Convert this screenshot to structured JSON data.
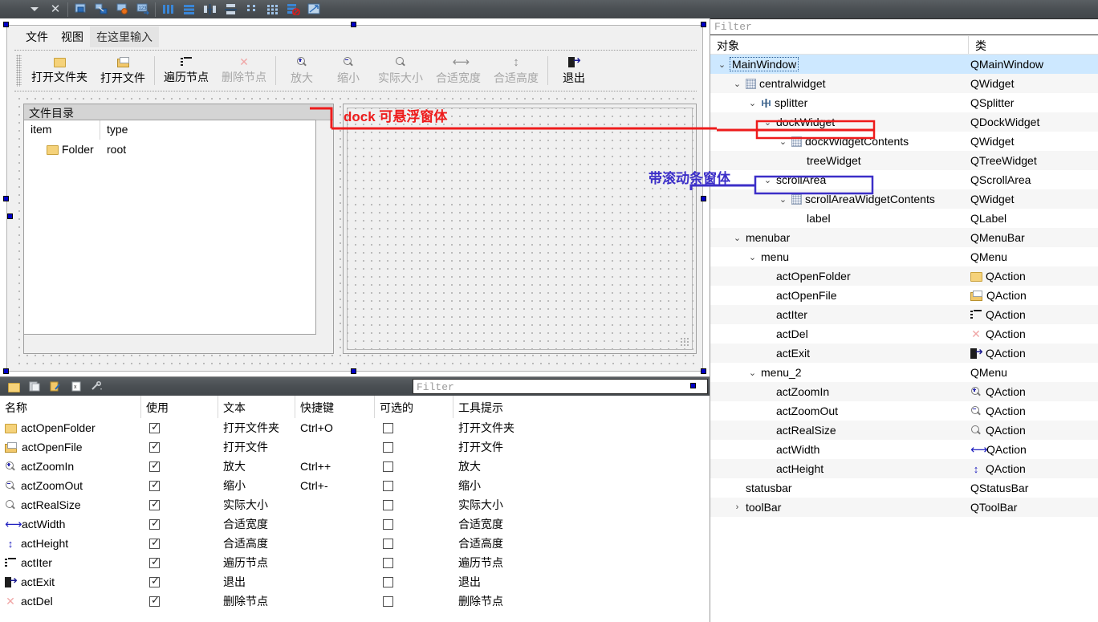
{
  "top_toolbar": {
    "icons": [
      {
        "name": "dropdown-caret",
        "label": "caret"
      },
      {
        "name": "close-icon",
        "label": "×"
      },
      {
        "name": "edit-widgets-icon",
        "label": "edit-widgets"
      },
      {
        "name": "edit-signals-icon",
        "label": "edit-signals"
      },
      {
        "name": "edit-buddies-icon",
        "label": "edit-buddies"
      },
      {
        "name": "edit-tab-order-icon",
        "label": "edit-tab-order"
      },
      {
        "name": "layout-horizontal-icon",
        "label": "layout-horizontal"
      },
      {
        "name": "layout-vertical-icon",
        "label": "layout-vertical"
      },
      {
        "name": "layout-hsplitter-icon",
        "label": "layout-h-splitter"
      },
      {
        "name": "layout-vsplitter-icon",
        "label": "layout-v-splitter"
      },
      {
        "name": "layout-form-icon",
        "label": "layout-form"
      },
      {
        "name": "layout-grid-icon",
        "label": "layout-grid"
      },
      {
        "name": "break-layout-icon",
        "label": "break-layout"
      },
      {
        "name": "adjust-size-icon",
        "label": "adjust-size"
      }
    ]
  },
  "form": {
    "menubar": [
      "文件",
      "视图"
    ],
    "menubar_placeholder": "在这里输入",
    "toolbar": [
      {
        "name": "open-folder",
        "label": "打开文件夹",
        "icon": "folder-icon",
        "disabled": false
      },
      {
        "name": "open-file",
        "label": "打开文件",
        "icon": "folder-open-icon",
        "disabled": false
      },
      {
        "name": "iter-node",
        "label": "遍历节点",
        "icon": "list-icon",
        "disabled": false
      },
      {
        "name": "del-node",
        "label": "删除节点",
        "icon": "x-icon",
        "disabled": true
      },
      {
        "name": "zoom-in",
        "label": "放大",
        "icon": "magnifier-plus-icon",
        "disabled": true
      },
      {
        "name": "zoom-out",
        "label": "缩小",
        "icon": "magnifier-minus-icon",
        "disabled": true
      },
      {
        "name": "real-size",
        "label": "实际大小",
        "icon": "magnifier-icon",
        "disabled": true
      },
      {
        "name": "fit-width",
        "label": "合适宽度",
        "icon": "arrow-h-icon",
        "disabled": true
      },
      {
        "name": "fit-height",
        "label": "合适高度",
        "icon": "arrow-v-icon",
        "disabled": true
      },
      {
        "name": "exit",
        "label": "退出",
        "icon": "exit-icon",
        "disabled": false
      }
    ],
    "dock_title": "文件目录",
    "tree": {
      "headers": [
        "item",
        "type"
      ],
      "rows": [
        {
          "item": "Folder",
          "type": "root",
          "icon": "folder-icon"
        }
      ]
    }
  },
  "annotations": [
    {
      "name": "dock-annotation",
      "text": "dock 可悬浮窗体",
      "color": "#ee1c1c"
    },
    {
      "name": "scrollarea-annotation",
      "text": "带滚动条窗体",
      "color": "#3c2fc8"
    }
  ],
  "action_editor": {
    "toolbar_icons": [
      {
        "name": "new-action-icon"
      },
      {
        "name": "copy-action-icon"
      },
      {
        "name": "edit-action-icon"
      },
      {
        "name": "delete-action-icon"
      },
      {
        "name": "configure-icon"
      }
    ],
    "filter_placeholder": "Filter",
    "headers": [
      "名称",
      "使用",
      "文本",
      "快捷键",
      "可选的",
      "工具提示"
    ],
    "rows": [
      {
        "name": "actOpenFolder",
        "icon": "folder-icon",
        "used": true,
        "text": "打开文件夹",
        "shortcut": "Ctrl+O",
        "checkable": false,
        "tooltip": "打开文件夹"
      },
      {
        "name": "actOpenFile",
        "icon": "folder-open-icon",
        "used": true,
        "text": "打开文件",
        "shortcut": "",
        "checkable": false,
        "tooltip": "打开文件"
      },
      {
        "name": "actZoomIn",
        "icon": "magnifier-plus-icon",
        "used": true,
        "text": "放大",
        "shortcut": "Ctrl++",
        "checkable": false,
        "tooltip": "放大"
      },
      {
        "name": "actZoomOut",
        "icon": "magnifier-minus-icon",
        "used": true,
        "text": "缩小",
        "shortcut": "Ctrl+-",
        "checkable": false,
        "tooltip": "缩小"
      },
      {
        "name": "actRealSize",
        "icon": "magnifier-icon",
        "used": true,
        "text": "实际大小",
        "shortcut": "",
        "checkable": false,
        "tooltip": "实际大小"
      },
      {
        "name": "actWidth",
        "icon": "arrow-h-icon",
        "used": true,
        "text": "合适宽度",
        "shortcut": "",
        "checkable": false,
        "tooltip": "合适宽度"
      },
      {
        "name": "actHeight",
        "icon": "arrow-v-icon",
        "used": true,
        "text": "合适高度",
        "shortcut": "",
        "checkable": false,
        "tooltip": "合适高度"
      },
      {
        "name": "actIter",
        "icon": "list-icon",
        "used": true,
        "text": "遍历节点",
        "shortcut": "",
        "checkable": false,
        "tooltip": "遍历节点"
      },
      {
        "name": "actExit",
        "icon": "exit-icon",
        "used": true,
        "text": "退出",
        "shortcut": "",
        "checkable": false,
        "tooltip": "退出"
      },
      {
        "name": "actDel",
        "icon": "x-icon",
        "used": true,
        "text": "删除节点",
        "shortcut": "",
        "checkable": false,
        "tooltip": "删除节点"
      }
    ]
  },
  "inspector": {
    "filter_placeholder": "Filter",
    "headers": [
      "对象",
      "类"
    ],
    "rows": [
      {
        "object": "MainWindow",
        "class": "QMainWindow",
        "indent": 0,
        "chev": "v",
        "icon": "none",
        "class_icon": "none",
        "selected": true
      },
      {
        "object": "centralwidget",
        "class": "QWidget",
        "indent": 1,
        "chev": "v",
        "icon": "grid",
        "class_icon": "none",
        "selected": false
      },
      {
        "object": "splitter",
        "class": "QSplitter",
        "indent": 2,
        "chev": "v",
        "icon": "split",
        "class_icon": "none",
        "selected": false
      },
      {
        "object": "dockWidget",
        "class": "QDockWidget",
        "indent": 3,
        "chev": "v",
        "icon": "none",
        "class_icon": "none",
        "selected": false,
        "box": "red"
      },
      {
        "object": "dockWidgetContents",
        "class": "QWidget",
        "indent": 4,
        "chev": "v",
        "icon": "grid",
        "class_icon": "none",
        "selected": false
      },
      {
        "object": "treeWidget",
        "class": "QTreeWidget",
        "indent": 5,
        "chev": "",
        "icon": "none",
        "class_icon": "none",
        "selected": false
      },
      {
        "object": "scrollArea",
        "class": "QScrollArea",
        "indent": 3,
        "chev": "v",
        "icon": "none",
        "class_icon": "none",
        "selected": false,
        "box": "blue"
      },
      {
        "object": "scrollAreaWidgetContents",
        "class": "QWidget",
        "indent": 4,
        "chev": "v",
        "icon": "grid",
        "class_icon": "none",
        "selected": false
      },
      {
        "object": "label",
        "class": "QLabel",
        "indent": 5,
        "chev": "",
        "icon": "none",
        "class_icon": "none",
        "selected": false
      },
      {
        "object": "menubar",
        "class": "QMenuBar",
        "indent": 1,
        "chev": "v",
        "icon": "none",
        "class_icon": "none",
        "selected": false
      },
      {
        "object": "menu",
        "class": "QMenu",
        "indent": 2,
        "chev": "v",
        "icon": "none",
        "class_icon": "none",
        "selected": false
      },
      {
        "object": "actOpenFolder",
        "class": "QAction",
        "indent": 3,
        "chev": "",
        "icon": "none",
        "class_icon": "folder-icon",
        "selected": false
      },
      {
        "object": "actOpenFile",
        "class": "QAction",
        "indent": 3,
        "chev": "",
        "icon": "none",
        "class_icon": "folder-open-icon",
        "selected": false
      },
      {
        "object": "actIter",
        "class": "QAction",
        "indent": 3,
        "chev": "",
        "icon": "none",
        "class_icon": "list-icon",
        "selected": false
      },
      {
        "object": "actDel",
        "class": "QAction",
        "indent": 3,
        "chev": "",
        "icon": "none",
        "class_icon": "x-icon",
        "selected": false
      },
      {
        "object": "actExit",
        "class": "QAction",
        "indent": 3,
        "chev": "",
        "icon": "none",
        "class_icon": "exit-icon",
        "selected": false
      },
      {
        "object": "menu_2",
        "class": "QMenu",
        "indent": 2,
        "chev": "v",
        "icon": "none",
        "class_icon": "none",
        "selected": false
      },
      {
        "object": "actZoomIn",
        "class": "QAction",
        "indent": 3,
        "chev": "",
        "icon": "none",
        "class_icon": "magnifier-plus-icon",
        "selected": false
      },
      {
        "object": "actZoomOut",
        "class": "QAction",
        "indent": 3,
        "chev": "",
        "icon": "none",
        "class_icon": "magnifier-minus-icon",
        "selected": false
      },
      {
        "object": "actRealSize",
        "class": "QAction",
        "indent": 3,
        "chev": "",
        "icon": "none",
        "class_icon": "magnifier-icon",
        "selected": false
      },
      {
        "object": "actWidth",
        "class": "QAction",
        "indent": 3,
        "chev": "",
        "icon": "none",
        "class_icon": "arrow-h-icon",
        "selected": false
      },
      {
        "object": "actHeight",
        "class": "QAction",
        "indent": 3,
        "chev": "",
        "icon": "none",
        "class_icon": "arrow-v-icon",
        "selected": false
      },
      {
        "object": "statusbar",
        "class": "QStatusBar",
        "indent": 1,
        "chev": "",
        "icon": "none",
        "class_icon": "none",
        "selected": false
      },
      {
        "object": "toolBar",
        "class": "QToolBar",
        "indent": 1,
        "chev": ">",
        "icon": "none",
        "class_icon": "none",
        "selected": false
      }
    ]
  },
  "colors": {
    "selection": "#cde8ff",
    "annotation_red": "#ee1c1c",
    "annotation_blue": "#3c2fc8",
    "handle": "#0000c8",
    "toolbar_dark": "#4a4f53"
  }
}
